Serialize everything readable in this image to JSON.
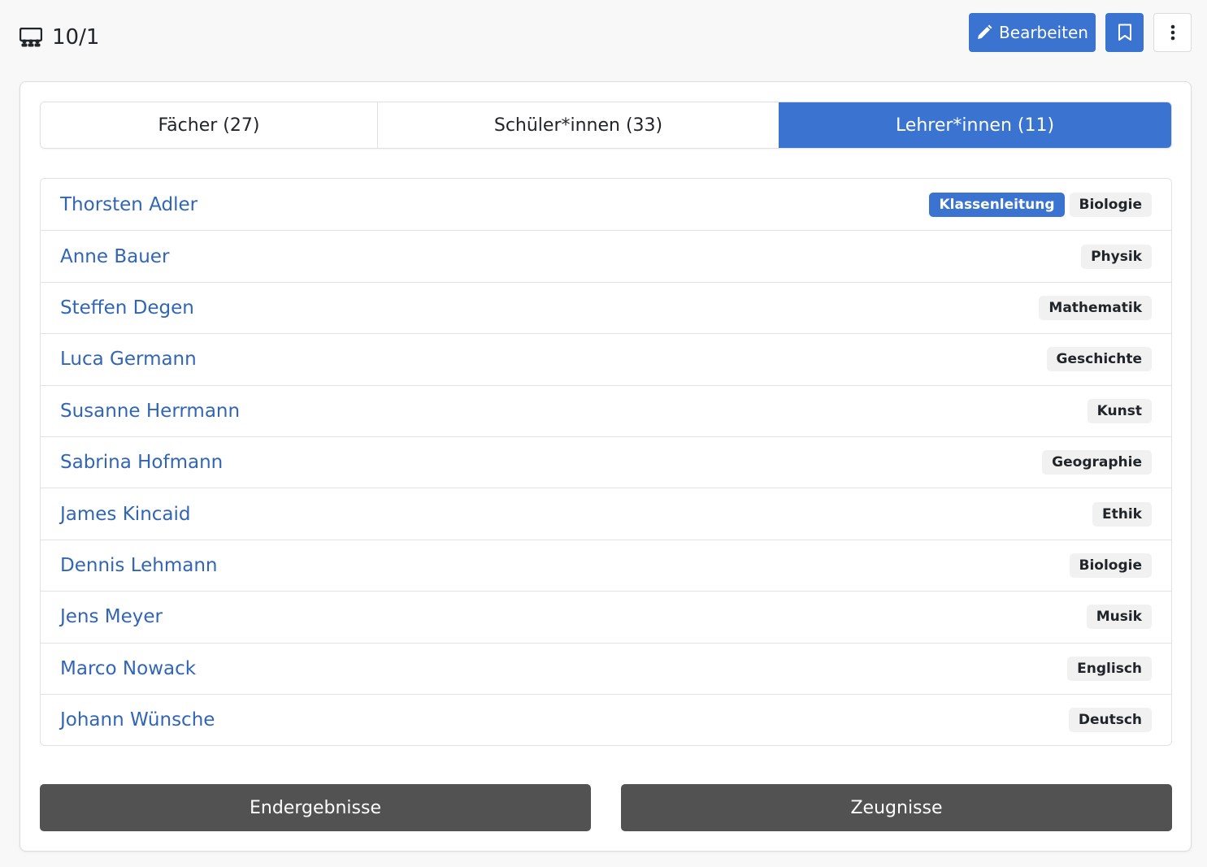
{
  "header": {
    "title": "10/1",
    "title_icon": "classroom-icon",
    "edit_label": "Bearbeiten",
    "edit_icon": "pencil-icon",
    "bookmark_icon": "bookmark-icon",
    "more_icon": "more-vertical-icon"
  },
  "tabs": [
    {
      "label": "Fächer (27)",
      "active": false
    },
    {
      "label": "Schüler*innen (33)",
      "active": false
    },
    {
      "label": "Lehrer*innen (11)",
      "active": true
    }
  ],
  "teachers": [
    {
      "name": "Thorsten Adler",
      "badges": [
        {
          "label": "Klassenleitung",
          "primary": true
        },
        {
          "label": "Biologie",
          "primary": false
        }
      ]
    },
    {
      "name": "Anne Bauer",
      "badges": [
        {
          "label": "Physik",
          "primary": false
        }
      ]
    },
    {
      "name": "Steffen Degen",
      "badges": [
        {
          "label": "Mathematik",
          "primary": false
        }
      ]
    },
    {
      "name": "Luca Germann",
      "badges": [
        {
          "label": "Geschichte",
          "primary": false
        }
      ]
    },
    {
      "name": "Susanne Herrmann",
      "badges": [
        {
          "label": "Kunst",
          "primary": false
        }
      ]
    },
    {
      "name": "Sabrina Hofmann",
      "badges": [
        {
          "label": "Geographie",
          "primary": false
        }
      ]
    },
    {
      "name": "James Kincaid",
      "badges": [
        {
          "label": "Ethik",
          "primary": false
        }
      ]
    },
    {
      "name": "Dennis Lehmann",
      "badges": [
        {
          "label": "Biologie",
          "primary": false
        }
      ]
    },
    {
      "name": "Jens Meyer",
      "badges": [
        {
          "label": "Musik",
          "primary": false
        }
      ]
    },
    {
      "name": "Marco Nowack",
      "badges": [
        {
          "label": "Englisch",
          "primary": false
        }
      ]
    },
    {
      "name": "Johann Wünsche",
      "badges": [
        {
          "label": "Deutsch",
          "primary": false
        }
      ]
    }
  ],
  "footer": {
    "results_label": "Endergebnisse",
    "reports_label": "Zeugnisse"
  },
  "colors": {
    "primary": "#3a73d0",
    "link": "#3165b6",
    "dark_button": "#525252",
    "background": "#f8f8f8"
  }
}
